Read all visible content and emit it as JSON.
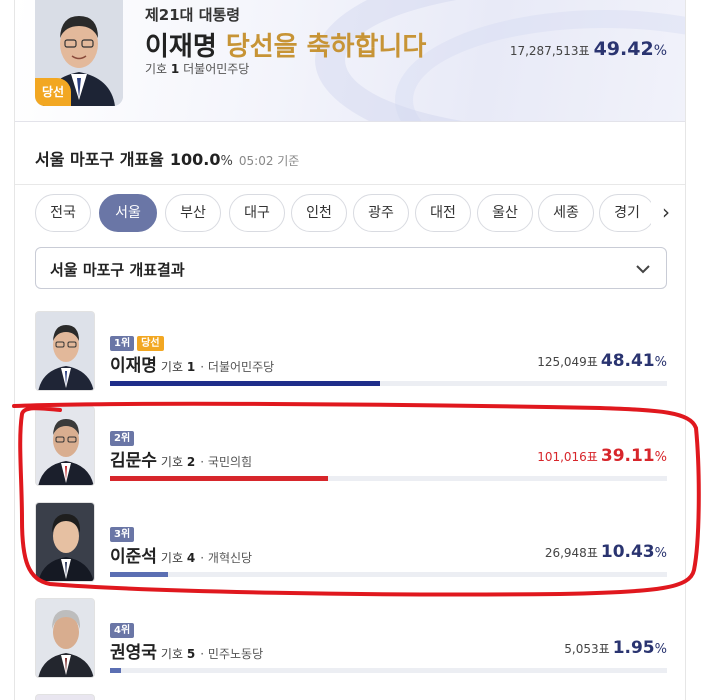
{
  "winner": {
    "election": "제21대 대통령",
    "name": "이재명",
    "congrats": "당선을 축하합니다",
    "badge": "당선",
    "number_label": "기호",
    "number": "1",
    "party": "더불어민주당",
    "votes": "17,287,513표",
    "percent": "49.42",
    "percent_unit": "%"
  },
  "count": {
    "label": "서울 마포구 개표율",
    "rate": "100.0",
    "unit": "%",
    "time": "05:02 기준"
  },
  "regions": [
    "전국",
    "서울",
    "부산",
    "대구",
    "인천",
    "광주",
    "대전",
    "울산",
    "세종",
    "경기"
  ],
  "selected_region": "서울",
  "dropdown": {
    "label": "서울 마포구 개표결과"
  },
  "candidates": [
    {
      "rank": "1위",
      "elected": "당선",
      "name": "이재명",
      "number_label": "기호",
      "number": "1",
      "party": "· 더불어민주당",
      "votes": "125,049표",
      "percent": "48.41",
      "unit": "%",
      "share": 48.41,
      "color": "#1f2e8a"
    },
    {
      "rank": "2위",
      "name": "김문수",
      "number_label": "기호",
      "number": "2",
      "party": "· 국민의힘",
      "votes": "101,016표",
      "percent": "39.11",
      "unit": "%",
      "share": 39.11,
      "color": "#d7262b"
    },
    {
      "rank": "3위",
      "name": "이준석",
      "number_label": "기호",
      "number": "4",
      "party": "· 개혁신당",
      "votes": "26,948표",
      "percent": "10.43",
      "unit": "%",
      "share": 10.43,
      "color": "#5b6fb3"
    },
    {
      "rank": "4위",
      "name": "권영국",
      "number_label": "기호",
      "number": "5",
      "party": "· 민주노동당",
      "votes": "5,053표",
      "percent": "1.95",
      "unit": "%",
      "share": 1.95,
      "color": "#5b6fb3"
    }
  ],
  "colors": {
    "accent": "#6a76a6",
    "winner_gold": "#c79436",
    "party_dem": "#1f2e8a",
    "party_ppp": "#d7262b",
    "annotation": "#e0181e"
  }
}
